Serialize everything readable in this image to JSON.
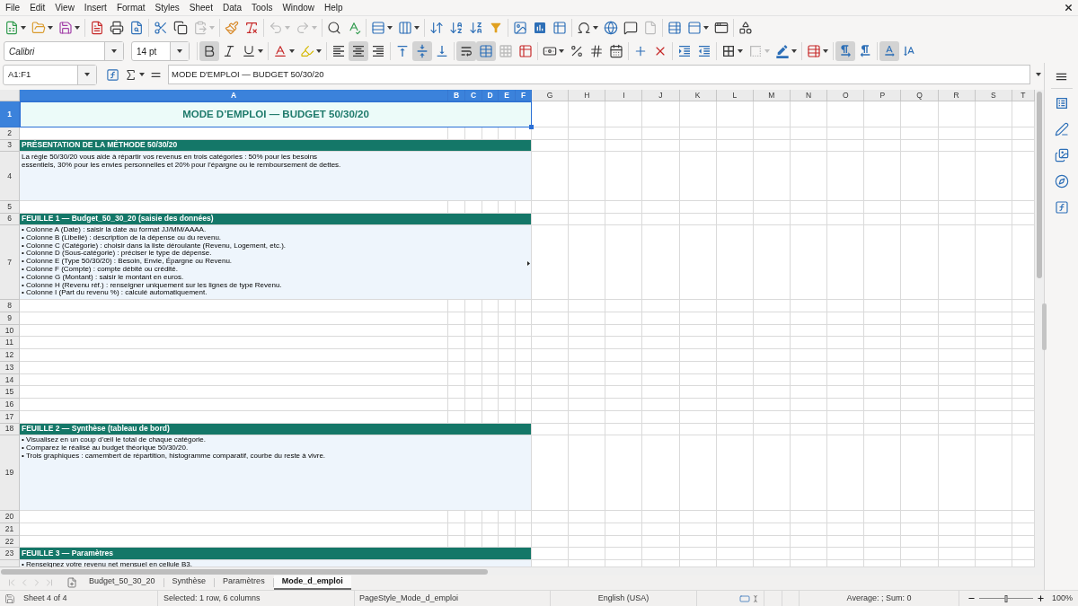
{
  "menu": [
    "File",
    "Edit",
    "View",
    "Insert",
    "Format",
    "Styles",
    "Sheet",
    "Data",
    "Tools",
    "Window",
    "Help"
  ],
  "standard_toolbar": {
    "paste": {
      "disabled": true
    },
    "undo": {
      "disabled": true
    },
    "redo": {
      "disabled": true
    },
    "headers_footers": {
      "disabled": true
    }
  },
  "formatting_toolbar": {
    "font_name": "Calibri",
    "font_size": "14 pt",
    "merge_cells": {
      "disabled": true
    },
    "border_style": {
      "disabled": true
    },
    "toggles": {
      "bold": true,
      "italic": false,
      "underline": false,
      "align_left": false,
      "align_center": true,
      "align_right": false,
      "align_top": false,
      "align_middle": true,
      "align_bottom": false,
      "wrap_text": true,
      "merge_and_center": true,
      "left_to_right": true,
      "right_to_left": false,
      "text_left_to_right": true,
      "text_top_to_bottom": false
    }
  },
  "formula_bar": {
    "name_box": "A1:F1",
    "content": "MODE D'EMPLOI — BUDGET 50/30/20"
  },
  "grid": {
    "columns": [
      {
        "label": "A",
        "selected": true
      },
      {
        "label": "B",
        "selected": true
      },
      {
        "label": "C",
        "selected": true
      },
      {
        "label": "D",
        "selected": true
      },
      {
        "label": "E",
        "selected": true
      },
      {
        "label": "F",
        "selected": true
      },
      {
        "label": "G",
        "selected": false
      },
      {
        "label": "H",
        "selected": false
      },
      {
        "label": "I",
        "selected": false
      },
      {
        "label": "J",
        "selected": false
      },
      {
        "label": "K",
        "selected": false
      },
      {
        "label": "L",
        "selected": false
      },
      {
        "label": "M",
        "selected": false
      },
      {
        "label": "N",
        "selected": false
      },
      {
        "label": "O",
        "selected": false
      },
      {
        "label": "P",
        "selected": false
      },
      {
        "label": "Q",
        "selected": false
      },
      {
        "label": "R",
        "selected": false
      },
      {
        "label": "S",
        "selected": false
      },
      {
        "label": "T",
        "selected": false
      }
    ],
    "rows": [
      {
        "label": "1",
        "selected": true,
        "kind": "title",
        "text": "MODE D’EMPLOI — BUDGET 50/30/20"
      },
      {
        "label": "2",
        "selected": false,
        "kind": "empty"
      },
      {
        "label": "3",
        "selected": false,
        "kind": "section",
        "text": "PRÉSENTATION DE LA MÉTHODE 50/30/20"
      },
      {
        "label": "4",
        "selected": false,
        "kind": "body",
        "text": "La règle 50/30/20 vous aide à répartir vos revenus en trois catégories : 50% pour les besoins\nessentiels, 30% pour les envies personnelles et 20% pour l’épargne ou le remboursement de dettes."
      },
      {
        "label": "5",
        "selected": false,
        "kind": "empty"
      },
      {
        "label": "6",
        "selected": false,
        "kind": "section",
        "text": "FEUILLE 1 — Budget_50_30_20 (saisie des données)"
      },
      {
        "label": "7",
        "selected": false,
        "kind": "body",
        "overflow": true,
        "lines": [
          "• Colonne A (Date) : saisir la date au format JJ/MM/AAAA.",
          "• Colonne B (Libellé) : description de la dépense ou du revenu.",
          "• Colonne C (Catégorie) : choisir dans la liste déroulante (Revenu, Logement, etc.).",
          "• Colonne D (Sous-catégorie) : préciser le type de dépense.",
          "• Colonne E (Type 50/30/20) : Besoin, Envie, Épargne ou Revenu.",
          "• Colonne F (Compte) : compte débité ou crédité.",
          "• Colonne G (Montant) : saisir le montant en euros.",
          "• Colonne H (Revenu réf.) : renseigner uniquement sur les lignes de type Revenu.",
          "• Colonne I (Part du revenu %) : calculé automatiquement."
        ]
      },
      {
        "label": "8",
        "selected": false,
        "kind": "empty"
      },
      {
        "label": "9",
        "selected": false,
        "kind": "empty"
      },
      {
        "label": "10",
        "selected": false,
        "kind": "empty"
      },
      {
        "label": "11",
        "selected": false,
        "kind": "empty"
      },
      {
        "label": "12",
        "selected": false,
        "kind": "empty"
      },
      {
        "label": "13",
        "selected": false,
        "kind": "empty"
      },
      {
        "label": "14",
        "selected": false,
        "kind": "empty"
      },
      {
        "label": "15",
        "selected": false,
        "kind": "empty"
      },
      {
        "label": "16",
        "selected": false,
        "kind": "empty"
      },
      {
        "label": "17",
        "selected": false,
        "kind": "empty"
      },
      {
        "label": "18",
        "selected": false,
        "kind": "section",
        "text": "FEUILLE 2 — Synthèse (tableau de bord)"
      },
      {
        "label": "19",
        "selected": false,
        "kind": "body",
        "lines": [
          "• Visualisez en un coup d’œil le total de chaque catégorie.",
          "• Comparez le réalisé au budget théorique 50/30/20.",
          "• Trois graphiques : camembert de répartition, histogramme comparatif, courbe du reste à vivre."
        ]
      },
      {
        "label": "20",
        "selected": false,
        "kind": "empty"
      },
      {
        "label": "21",
        "selected": false,
        "kind": "empty"
      },
      {
        "label": "22",
        "selected": false,
        "kind": "empty"
      },
      {
        "label": "23",
        "selected": false,
        "kind": "section",
        "text": "FEUILLE 3 — Paramètres"
      },
      {
        "selected": false,
        "kind": "body",
        "lines": [
          "• Renseignez votre revenu net mensuel en cellule B3."
        ]
      }
    ]
  },
  "sheet_tabs": [
    {
      "label": "Budget_50_30_20",
      "selected": false
    },
    {
      "label": "Synthèse",
      "selected": false
    },
    {
      "label": "Paramètres",
      "selected": false
    },
    {
      "label": "Mode_d_emploi",
      "selected": true
    }
  ],
  "status_bar": {
    "sheet": "Sheet 4 of 4",
    "selection": "Selected: 1 row, 6 columns",
    "page_style": "PageStyle_Mode_d_emploi",
    "language": "English (USA)",
    "summary": "Average: ; Sum: 0",
    "zoom": {
      "level": 0.5,
      "reading": "100%"
    }
  }
}
